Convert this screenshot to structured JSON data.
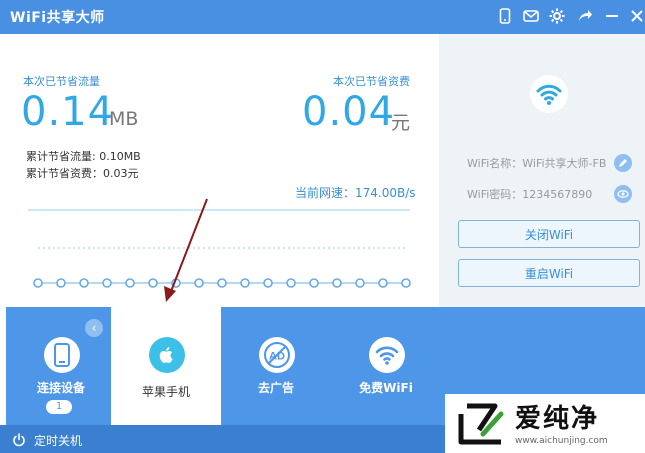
{
  "window": {
    "title": "WiFi共享大师"
  },
  "stats": {
    "traffic_label": "本次已节省流量",
    "traffic_value": "0.14",
    "traffic_unit": "MB",
    "money_label": "本次已节省资费",
    "money_value": "0.04",
    "money_unit": "元",
    "total_traffic": "累计节省流量: 0.10MB",
    "total_money": "累计节省资费：0.03元",
    "speed": "当前网速：174.00B/s"
  },
  "info": {
    "wifi_name": "WiFi名称：WiFi共享大师-FB",
    "wifi_password": "WiFi密码：1234567890",
    "close_button": "关闭WiFi",
    "restart_button": "重启WiFi"
  },
  "bottom": {
    "tiles": [
      {
        "label": "连接设备",
        "badge": "1"
      },
      {
        "label": "苹果手机"
      },
      {
        "label": "去广告"
      },
      {
        "label": "免费WiFi"
      }
    ],
    "collapse": "‹",
    "ad_icon_text": "AD"
  },
  "footer": {
    "shutdown_label": "定时关机"
  },
  "watermark": {
    "text": "爱纯净",
    "url": "www.aichunjing.com"
  },
  "colors": {
    "titlebar": "#4a90e2",
    "accent": "#30a8e6",
    "bottom_bar": "#4e96e8",
    "footer": "#3b7fd0",
    "arrow": "#8b1a1a"
  }
}
